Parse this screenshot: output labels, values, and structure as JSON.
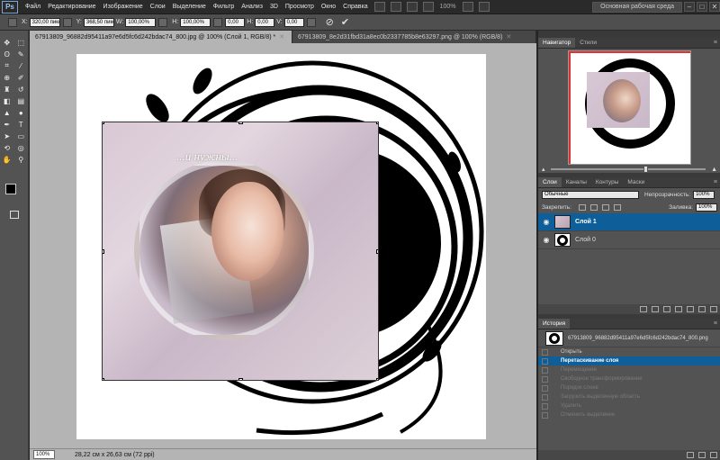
{
  "menubar": {
    "logo": "Ps",
    "items": [
      "Файл",
      "Редактирование",
      "Изображение",
      "Слои",
      "Выделение",
      "Фильтр",
      "Анализ",
      "3D",
      "Просмотр",
      "Окно",
      "Справка"
    ],
    "zoom": "100%",
    "workspace": "Основная рабочая среда"
  },
  "options": {
    "x_label": "X:",
    "x_value": "320,00 пикс",
    "y_label": "Y:",
    "y_value": "368,50 пикс",
    "w_label": "W:",
    "w_value": "100,00%",
    "h_label": "H:",
    "h_value": "100,00%",
    "angle_value": "0,00",
    "h_skew_label": "H:",
    "h_skew_value": "0,00",
    "v_skew_label": "V:",
    "v_skew_value": "0,00"
  },
  "document": {
    "tabs": [
      {
        "label": "67913809_96882d95411a97e6d5fc6d242bdac74_800.jpg @ 100% (Слой 1, RGB/8) *",
        "active": true
      },
      {
        "label": "67913809_8e2d31fbd31a8ec0b2337785b8e63297.png @ 100% (RGB/8)",
        "active": false
      }
    ],
    "canvas_text": "...и нужны..."
  },
  "status": {
    "zoom": "100%",
    "info": "28,22 см x 26,63 см (72 ppi)"
  },
  "navigator": {
    "tabs": [
      "Навигатор",
      "Стили"
    ]
  },
  "layers": {
    "tabs": [
      "Слои",
      "Каналы",
      "Контуры",
      "Маски"
    ],
    "blend_mode": "Обычные",
    "opacity_label": "Непрозрачность:",
    "opacity_value": "100%",
    "lock_label": "Закрепить:",
    "fill_label": "Заливка:",
    "fill_value": "100%",
    "items": [
      {
        "name": "Слой 1",
        "selected": true
      },
      {
        "name": "Слой 0",
        "selected": false
      }
    ]
  },
  "history": {
    "tabs": [
      "История"
    ],
    "snapshot": "67913809_96882d95411a97e6d5fc6d242bdac74_800.png",
    "steps": [
      {
        "label": "Открыть",
        "state": "normal"
      },
      {
        "label": "Перетаскивание слоя",
        "state": "current"
      },
      {
        "label": "Перемещение",
        "state": "undone"
      },
      {
        "label": "Свободное трансформирование",
        "state": "undone"
      },
      {
        "label": "Порядок слоев",
        "state": "undone"
      },
      {
        "label": "Загрузить выделенную область",
        "state": "undone"
      },
      {
        "label": "Удалить",
        "state": "undone"
      },
      {
        "label": "Отменить выделение",
        "state": "undone"
      }
    ]
  },
  "colors": {
    "accent": "#0e5e9a",
    "canvas_bg": "#b4b4b4",
    "panel_bg": "#535353",
    "nav_frame": "#e03030"
  }
}
